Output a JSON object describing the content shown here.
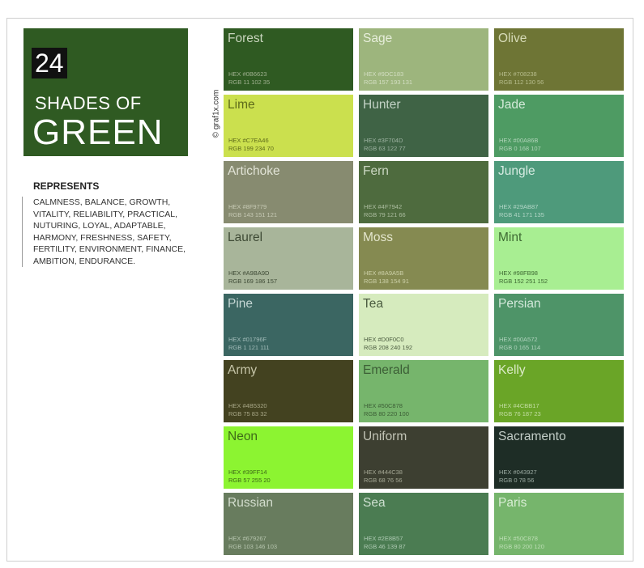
{
  "header": {
    "count": "24",
    "title_line1": "SHADES OF",
    "title_line2": "GREEN",
    "credit": "© graf1x.com",
    "colors": {
      "block_bg": "#2F5A22",
      "count_bg": "#111111"
    }
  },
  "represents": {
    "title": "REPRESENTS",
    "text": "CALMNESS, BALANCE, GROWTH, VITALITY, RELIABILITY, PRACTICAL, NUTURING, LOYAL, ADAPTABLE, HARMONY, FRESHNESS, SAFETY, FERTILITY, ENVIRONMENT, FINANCE, AMBITION, ENDURANCE."
  },
  "swatches": [
    {
      "name": "Forest",
      "hex_label": "HEX #0B6623",
      "rgb_label": "RGB 11 102 35",
      "bg": "#2F5A22",
      "name_color": "#C9D5BE",
      "label_color": "#9FB08F"
    },
    {
      "name": "Sage",
      "hex_label": "HEX #9DC183",
      "rgb_label": "RGB 157 193 131",
      "bg": "#9DB57D",
      "name_color": "#E7EEDB",
      "label_color": "#D3DEC2"
    },
    {
      "name": "Olive",
      "hex_label": "HEX #708238",
      "rgb_label": "RGB 112 130 56",
      "bg": "#6E7535",
      "name_color": "#D7DBB8",
      "label_color": "#B6BC8C"
    },
    {
      "name": "Lime",
      "hex_label": "HEX #C7EA46",
      "rgb_label": "RGB 199 234 70",
      "bg": "#CBE04E",
      "name_color": "#5E6B1A",
      "label_color": "#5E6B1A"
    },
    {
      "name": "Hunter",
      "hex_label": "HEX #3F704D",
      "rgb_label": "RGB 63 122 77",
      "bg": "#3F6345",
      "name_color": "#C3D3C6",
      "label_color": "#9DB2A1"
    },
    {
      "name": "Jade",
      "hex_label": "HEX #00A86B",
      "rgb_label": "RGB 0 168 107",
      "bg": "#4E9B63",
      "name_color": "#D4EAD9",
      "label_color": "#B1D4BA"
    },
    {
      "name": "Artichoke",
      "hex_label": "HEX #8F9779",
      "rgb_label": "RGB 143 151 121",
      "bg": "#878B70",
      "name_color": "#E1E3D6",
      "label_color": "#C7CAB5"
    },
    {
      "name": "Fern",
      "hex_label": "HEX #4F7942",
      "rgb_label": "RGB 79 121 66",
      "bg": "#4E6B3E",
      "name_color": "#CBD7C2",
      "label_color": "#ACBDA0"
    },
    {
      "name": "Jungle",
      "hex_label": "HEX #29AB87",
      "rgb_label": "RGB 41 171 135",
      "bg": "#4E9A7B",
      "name_color": "#D6EBE2",
      "label_color": "#B3D6C7"
    },
    {
      "name": "Laurel",
      "hex_label": "HEX #A9BA9D",
      "rgb_label": "RGB 169 186 157",
      "bg": "#A8B59A",
      "name_color": "#3E4A35",
      "label_color": "#3E4A35"
    },
    {
      "name": "Moss",
      "hex_label": "HEX #8A9A5B",
      "rgb_label": "RGB 138 154 91",
      "bg": "#858A51",
      "name_color": "#E3E5CC",
      "label_color": "#CCD0A8"
    },
    {
      "name": "Mint",
      "hex_label": "HEX #98FB98",
      "rgb_label": "RGB 152 251 152",
      "bg": "#A8EE92",
      "name_color": "#3E6A33",
      "label_color": "#3E6A33"
    },
    {
      "name": "Pine",
      "hex_label": "HEX #01796F",
      "rgb_label": "RGB 1 121 111",
      "bg": "#3B6662",
      "name_color": "#C4D6D4",
      "label_color": "#A2BCB9"
    },
    {
      "name": "Tea",
      "hex_label": "HEX #D0F0C0",
      "rgb_label": "RGB 208 240 192",
      "bg": "#D6EBBE",
      "name_color": "#4B5C40",
      "label_color": "#4B5C40"
    },
    {
      "name": "Persian",
      "hex_label": "HEX #00A572",
      "rgb_label": "RGB 0 165 114",
      "bg": "#4E9468",
      "name_color": "#D3E8DB",
      "label_color": "#B0D2BD"
    },
    {
      "name": "Army",
      "hex_label": "HEX #4B5320",
      "rgb_label": "RGB 75 83 32",
      "bg": "#434220",
      "name_color": "#C6C5A8",
      "label_color": "#A7A686"
    },
    {
      "name": "Emerald",
      "hex_label": "HEX #50C878",
      "rgb_label": "RGB 80 220 100",
      "bg": "#76B56C",
      "name_color": "#3C5E36",
      "label_color": "#3C5E36"
    },
    {
      "name": "Kelly",
      "hex_label": "HEX #4CBB17",
      "rgb_label": "RGB 76 187 23",
      "bg": "#6AA527",
      "name_color": "#DCEBC8",
      "label_color": "#C3DDA3"
    },
    {
      "name": "Neon",
      "hex_label": "HEX #39FF14",
      "rgb_label": "RGB 57 255 20",
      "bg": "#8CF431",
      "name_color": "#3E6A18",
      "label_color": "#3E6A18"
    },
    {
      "name": "Uniform",
      "hex_label": "HEX #444C38",
      "rgb_label": "RGB 68 76 56",
      "bg": "#3D3F31",
      "name_color": "#C2C4B6",
      "label_color": "#A4A794"
    },
    {
      "name": "Sacramento",
      "hex_label": "HEX #043927",
      "rgb_label": "RGB 0 78 56",
      "bg": "#1E2D26",
      "name_color": "#C1CCC6",
      "label_color": "#9CABA3"
    },
    {
      "name": "Russian",
      "hex_label": "HEX #679267",
      "rgb_label": "RGB 103 146 103",
      "bg": "#687C5E",
      "name_color": "#D3DDCE",
      "label_color": "#B6C5AE"
    },
    {
      "name": "Sea",
      "hex_label": "HEX #2E8B57",
      "rgb_label": "RGB 46 139 87",
      "bg": "#4B7C52",
      "name_color": "#CEE0D1",
      "label_color": "#ADC9B2"
    },
    {
      "name": "Paris",
      "hex_label": "HEX #50C878",
      "rgb_label": "RGB 80 200 120",
      "bg": "#76B56C",
      "name_color": "#D8EDD4",
      "label_color": "#BEDEB6"
    }
  ]
}
